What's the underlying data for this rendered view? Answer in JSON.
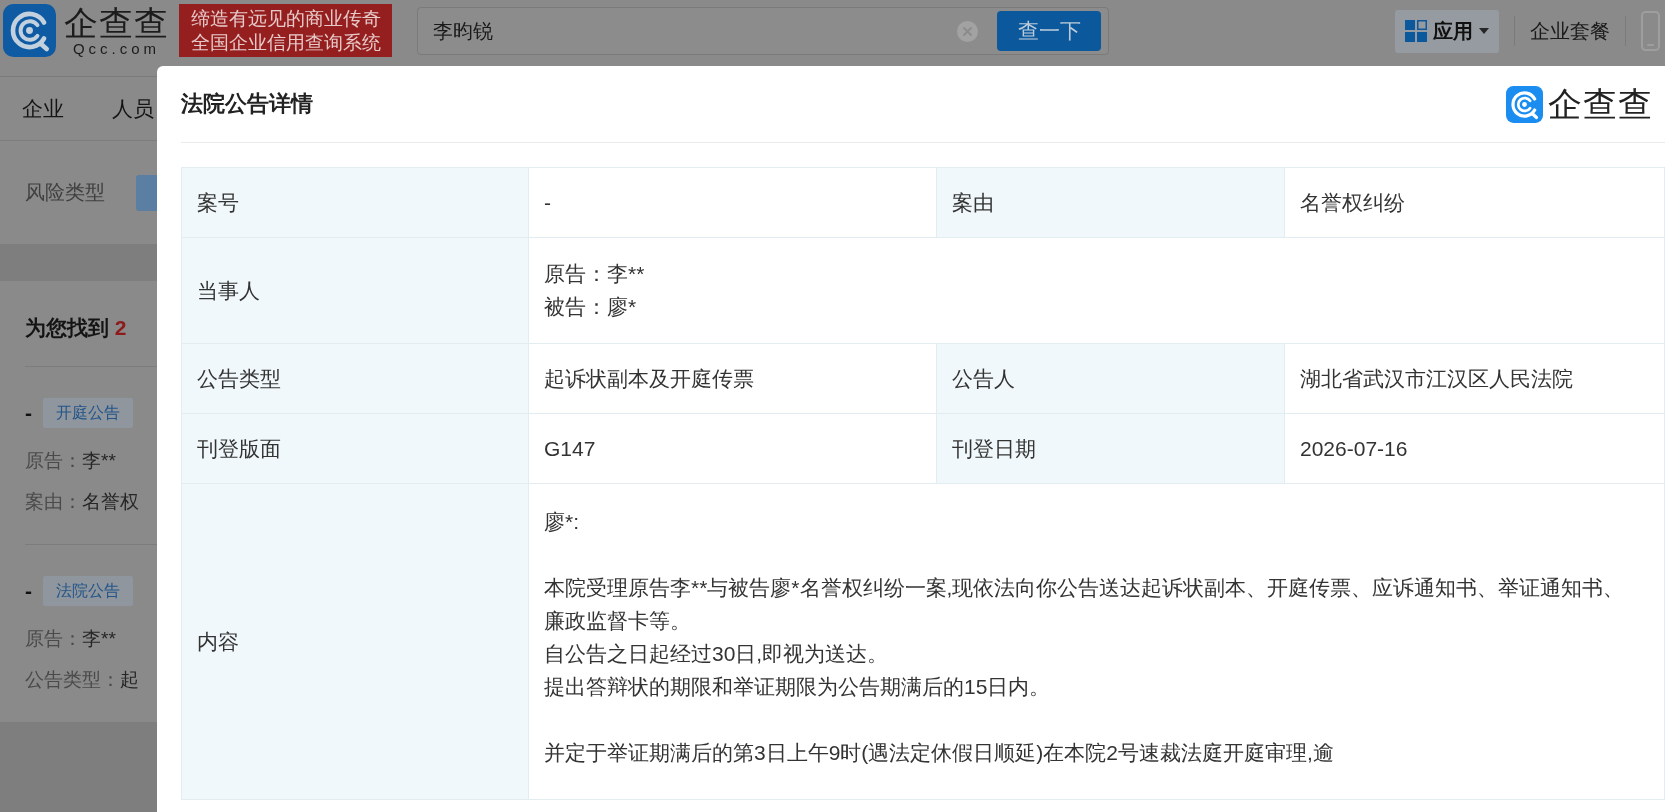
{
  "header": {
    "logo": {
      "name": "企查查",
      "domain": "Qcc.com"
    },
    "slogan": [
      "缔造有远见的商业传奇",
      "全国企业信用查询系统"
    ],
    "search": {
      "value": "李昀锐",
      "button": "查一下"
    },
    "apps_menu": {
      "label": "应用"
    },
    "links": [
      "企业套餐"
    ]
  },
  "nav": {
    "items": [
      "企业",
      "人员"
    ]
  },
  "filter": {
    "label": "风险类型"
  },
  "results": {
    "summary": "为您找到",
    "count": "2",
    "items": [
      {
        "marker": "-",
        "tag": "开庭公告",
        "fields": [
          {
            "label": "原告：",
            "value": "李**"
          },
          {
            "label": "案由：",
            "value": "名誉权"
          }
        ]
      },
      {
        "marker": "-",
        "tag": "法院公告",
        "fields": [
          {
            "label": "原告：",
            "value": "李**"
          },
          {
            "label": "公告类型：",
            "value": "起"
          }
        ]
      }
    ]
  },
  "modal": {
    "title": "法院公告详情",
    "logo": "企查查",
    "rows": [
      {
        "fields": [
          {
            "label": "案号",
            "paragraphs": [
              [
                "-"
              ]
            ]
          },
          {
            "label": "案由",
            "paragraphs": [
              [
                "名誉权纠纷"
              ]
            ]
          }
        ]
      },
      {
        "fields": [
          {
            "label": "当事人",
            "paragraphs": [
              [
                "原告：李**",
                "被告：廖*"
              ]
            ]
          }
        ]
      },
      {
        "fields": [
          {
            "label": "公告类型",
            "paragraphs": [
              [
                "起诉状副本及开庭传票"
              ]
            ]
          },
          {
            "label": "公告人",
            "paragraphs": [
              [
                "湖北省武汉市江汉区人民法院"
              ]
            ]
          }
        ]
      },
      {
        "fields": [
          {
            "label": "刊登版面",
            "paragraphs": [
              [
                "G147"
              ]
            ]
          },
          {
            "label": "刊登日期",
            "paragraphs": [
              [
                "2026-07-16"
              ]
            ]
          }
        ]
      },
      {
        "fields": [
          {
            "label": "内容",
            "paragraphs": [
              [
                "廖*:"
              ],
              [
                "本院受理原告李**与被告廖*名誉权纠纷一案,现依法向你公告送达起诉状副本、开庭传票、应诉通知书、举证通知书、",
                "廉政监督卡等。",
                "自公告之日起经过30日,即视为送达。",
                "提出答辩状的期限和举证期限为公告期满后的15日内。"
              ],
              [
                "并定于举证期满后的第3日上午9时(遇法定休假日顺延)在本院2号速裁法庭开庭审理,逾"
              ]
            ]
          }
        ]
      }
    ]
  }
}
